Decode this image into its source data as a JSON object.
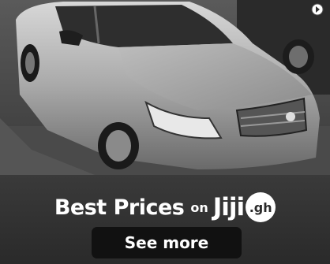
{
  "ad": {
    "photo_subject": "silver-sedan",
    "ad_choices_icon": "ad-choices-icon",
    "headline": {
      "main": "Best Prices",
      "connector": "on",
      "brand_name": "Jiji",
      "brand_suffix": ".gh"
    },
    "cta_label": "See more"
  },
  "colors": {
    "banner_background": "#2f2f2f",
    "button_background": "#111111",
    "text": "#ffffff"
  }
}
